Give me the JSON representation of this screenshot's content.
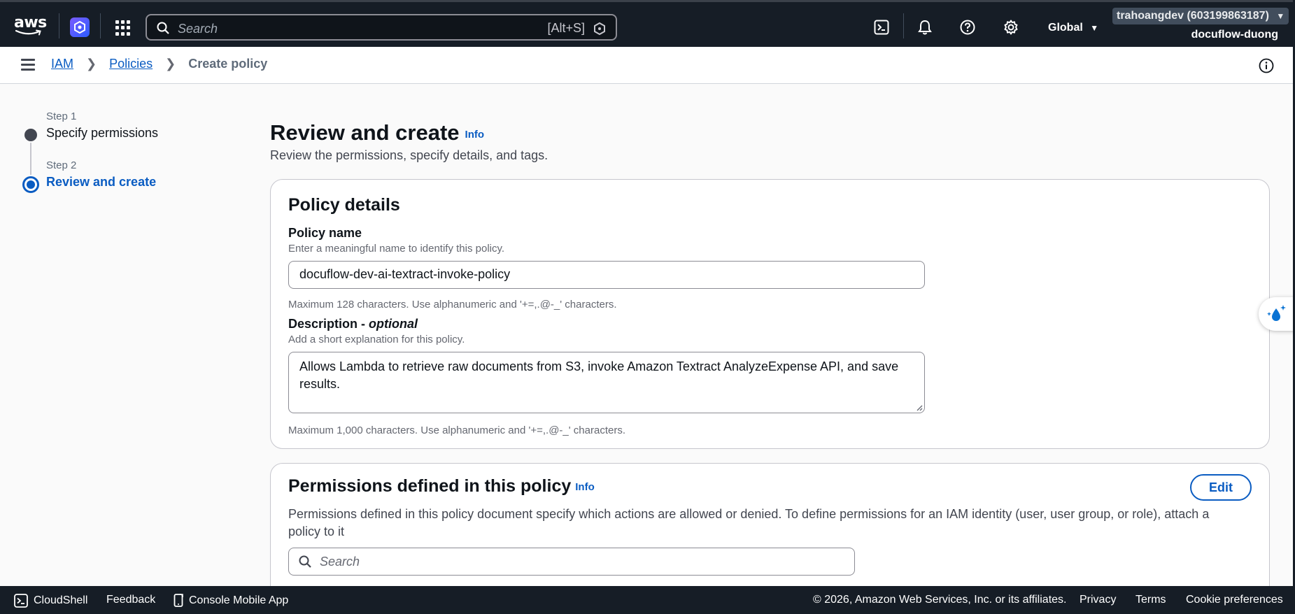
{
  "topnav": {
    "logo_text": "aws",
    "search_placeholder": "Search",
    "search_shortcut": "[Alt+S]",
    "region": "Global",
    "account": "trahoangdev (603199863187)",
    "account_alias": "docuflow-duong"
  },
  "breadcrumb": {
    "items": [
      "IAM",
      "Policies"
    ],
    "current": "Create policy"
  },
  "steps": [
    {
      "label": "Step 1",
      "title": "Specify permissions",
      "state": "completed"
    },
    {
      "label": "Step 2",
      "title": "Review and create",
      "state": "active"
    }
  ],
  "page": {
    "title": "Review and create",
    "info": "Info",
    "description": "Review the permissions, specify details, and tags."
  },
  "policy_details": {
    "heading": "Policy details",
    "name_label": "Policy name",
    "name_desc": "Enter a meaningful name to identify this policy.",
    "name_value": "docuflow-dev-ai-textract-invoke-policy",
    "name_constraint": "Maximum 128 characters. Use alphanumeric and '+=,.@-_' characters.",
    "description_label": "Description - ",
    "description_optional": "optional",
    "description_desc": "Add a short explanation for this policy.",
    "description_value": "Allows Lambda to retrieve raw documents from S3, invoke Amazon Textract AnalyzeExpense API, and save results.",
    "description_constraint": "Maximum 1,000 characters. Use alphanumeric and '+=,.@-_' characters."
  },
  "permissions": {
    "heading": "Permissions defined in this policy",
    "info": "Info",
    "edit_label": "Edit",
    "description": "Permissions defined in this policy document specify which actions are allowed or denied. To define permissions for an IAM identity (user, user group, or role), attach a policy to it",
    "search_placeholder": "Search"
  },
  "footer": {
    "cloudshell": "CloudShell",
    "feedback": "Feedback",
    "mobile_app": "Console Mobile App",
    "copyright": "© 2026, Amazon Web Services, Inc. or its affiliates.",
    "privacy": "Privacy",
    "terms": "Terms",
    "cookies": "Cookie preferences"
  },
  "colors": {
    "nav_bg": "#161d26",
    "link": "#0a5cc2",
    "active_step": "#0a5cc2",
    "completed_step": "#424650"
  }
}
